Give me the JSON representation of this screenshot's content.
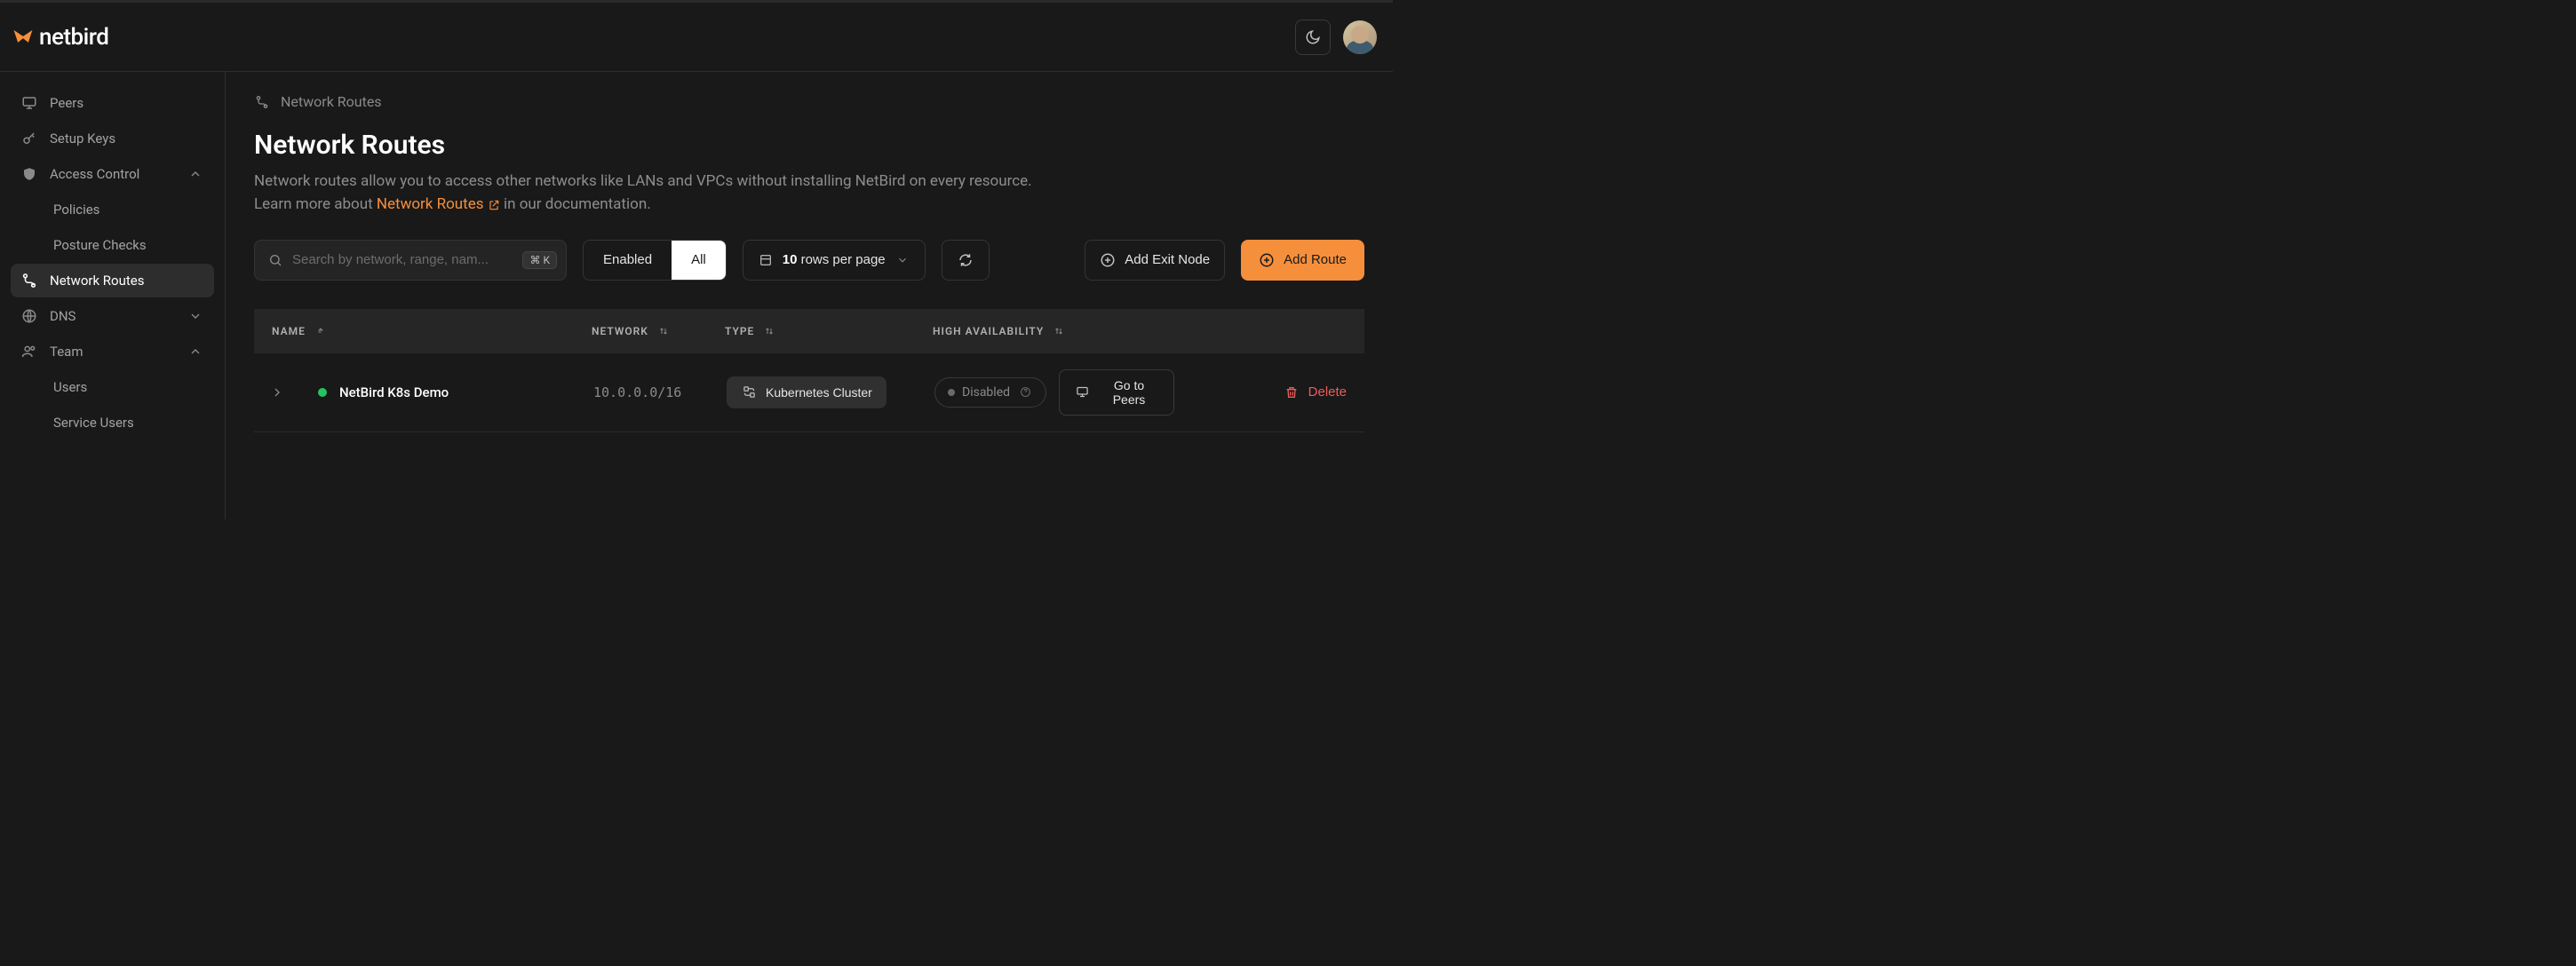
{
  "brand": {
    "name": "netbird"
  },
  "sidebar": {
    "items": [
      {
        "label": "Peers"
      },
      {
        "label": "Setup Keys"
      },
      {
        "label": "Access Control"
      },
      {
        "label": "Policies"
      },
      {
        "label": "Posture Checks"
      },
      {
        "label": "Network Routes"
      },
      {
        "label": "DNS"
      },
      {
        "label": "Team"
      },
      {
        "label": "Users"
      },
      {
        "label": "Service Users"
      }
    ]
  },
  "breadcrumb": {
    "label": "Network Routes"
  },
  "page": {
    "title": "Network Routes",
    "desc_1": "Network routes allow you to access other networks like LANs and VPCs without installing NetBird on every resource.",
    "desc_2a": "Learn more about ",
    "desc_link": "Network Routes",
    "desc_2b": " in our documentation."
  },
  "toolbar": {
    "search_placeholder": "Search by network, range, nam...",
    "kbd": "⌘ K",
    "filter_enabled": "Enabled",
    "filter_all": "All",
    "rows_value": "10",
    "rows_label": "rows per page",
    "add_exit": "Add Exit Node",
    "add_route": "Add Route"
  },
  "table": {
    "columns": {
      "name": "Name",
      "network": "Network",
      "type": "Type",
      "ha": "High Availability"
    },
    "rows": [
      {
        "name": "NetBird K8s Demo",
        "status": "active",
        "network": "10.0.0.0/16",
        "type": "Kubernetes Cluster",
        "ha": "Disabled",
        "peers_label": "Go to Peers",
        "delete_label": "Delete"
      }
    ]
  }
}
